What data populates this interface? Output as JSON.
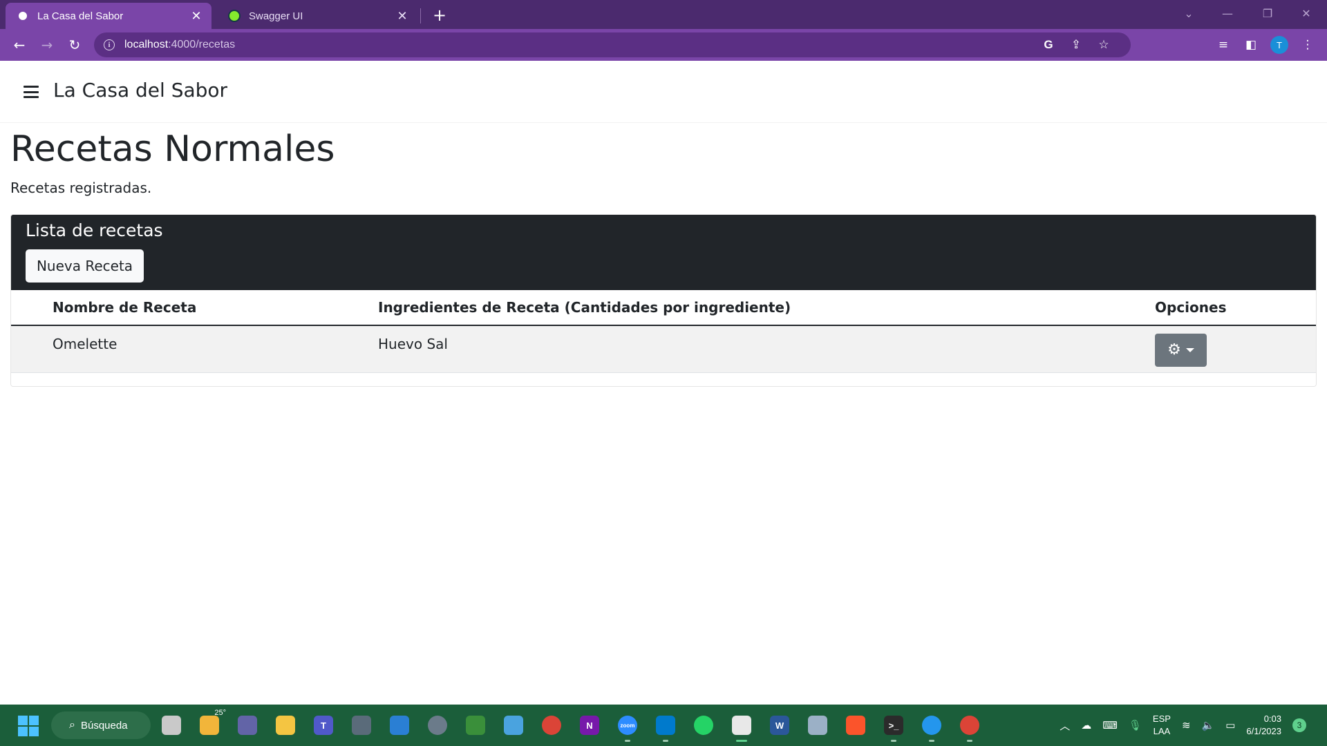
{
  "browser": {
    "tabs": [
      {
        "title": "La Casa del Sabor",
        "active": true
      },
      {
        "title": "Swagger UI",
        "active": false
      }
    ],
    "url_host": "localhost",
    "url_rest": ":4000/recetas",
    "avatar_letter": "T",
    "colors": {
      "frame": "#4b2a6e",
      "toolbar": "#7a45a8"
    }
  },
  "app": {
    "brand": "La Casa del Sabor"
  },
  "page": {
    "title": "Recetas Normales",
    "subtitle": "Recetas registradas."
  },
  "card": {
    "title": "Lista de recetas",
    "new_button": "Nueva Receta"
  },
  "table": {
    "headers": [
      "Nombre de Receta",
      "Ingredientes de Receta (Cantidades por ingrediente)",
      "Opciones"
    ],
    "rows": [
      {
        "name": "Omelette",
        "ingredients": "Huevo Sal"
      }
    ]
  },
  "taskbar": {
    "search_label": "Búsqueda",
    "weather_temp": "25°",
    "lang_top": "ESP",
    "lang_bottom": "LAA",
    "time": "0:03",
    "date": "6/1/2023",
    "notification_count": "3",
    "apps": [
      {
        "name": "task-view-icon",
        "color": "#c9c9c9",
        "label": ""
      },
      {
        "name": "weather-icon",
        "color": "#f2b53a",
        "label": ""
      },
      {
        "name": "meet-icon",
        "color": "#6264a7",
        "label": ""
      },
      {
        "name": "file-explorer-icon",
        "color": "#f4c542",
        "label": ""
      },
      {
        "name": "teams-icon",
        "color": "#5059c9",
        "label": "T"
      },
      {
        "name": "calculator-icon",
        "color": "#5a6b7a",
        "label": ""
      },
      {
        "name": "mail-icon",
        "color": "#2a7fd4",
        "label": ""
      },
      {
        "name": "settings-icon",
        "color": "#6b7b8a",
        "label": ""
      },
      {
        "name": "app-green-icon",
        "color": "#3a8f3a",
        "label": ""
      },
      {
        "name": "control-panel-icon",
        "color": "#4aa3df",
        "label": ""
      },
      {
        "name": "chrome-icon",
        "color": "#db4437",
        "label": ""
      },
      {
        "name": "onenote-icon",
        "color": "#7719aa",
        "label": "N"
      },
      {
        "name": "zoom-icon",
        "color": "#2d8cff",
        "label": "zoom"
      },
      {
        "name": "vscode-icon",
        "color": "#007acc",
        "label": ""
      },
      {
        "name": "whatsapp-icon",
        "color": "#25d366",
        "label": ""
      },
      {
        "name": "snipping-tool-icon",
        "color": "#e8e8e8",
        "label": ""
      },
      {
        "name": "word-icon",
        "color": "#2b579a",
        "label": "W"
      },
      {
        "name": "virtualbox-icon",
        "color": "#9bb0c6",
        "label": ""
      },
      {
        "name": "brave-icon",
        "color": "#fb542b",
        "label": ""
      },
      {
        "name": "terminal-icon",
        "color": "#2b2b2b",
        "label": ">_"
      },
      {
        "name": "docker-icon",
        "color": "#2496ed",
        "label": ""
      },
      {
        "name": "chrome-profile-icon",
        "color": "#db4437",
        "label": ""
      }
    ]
  }
}
